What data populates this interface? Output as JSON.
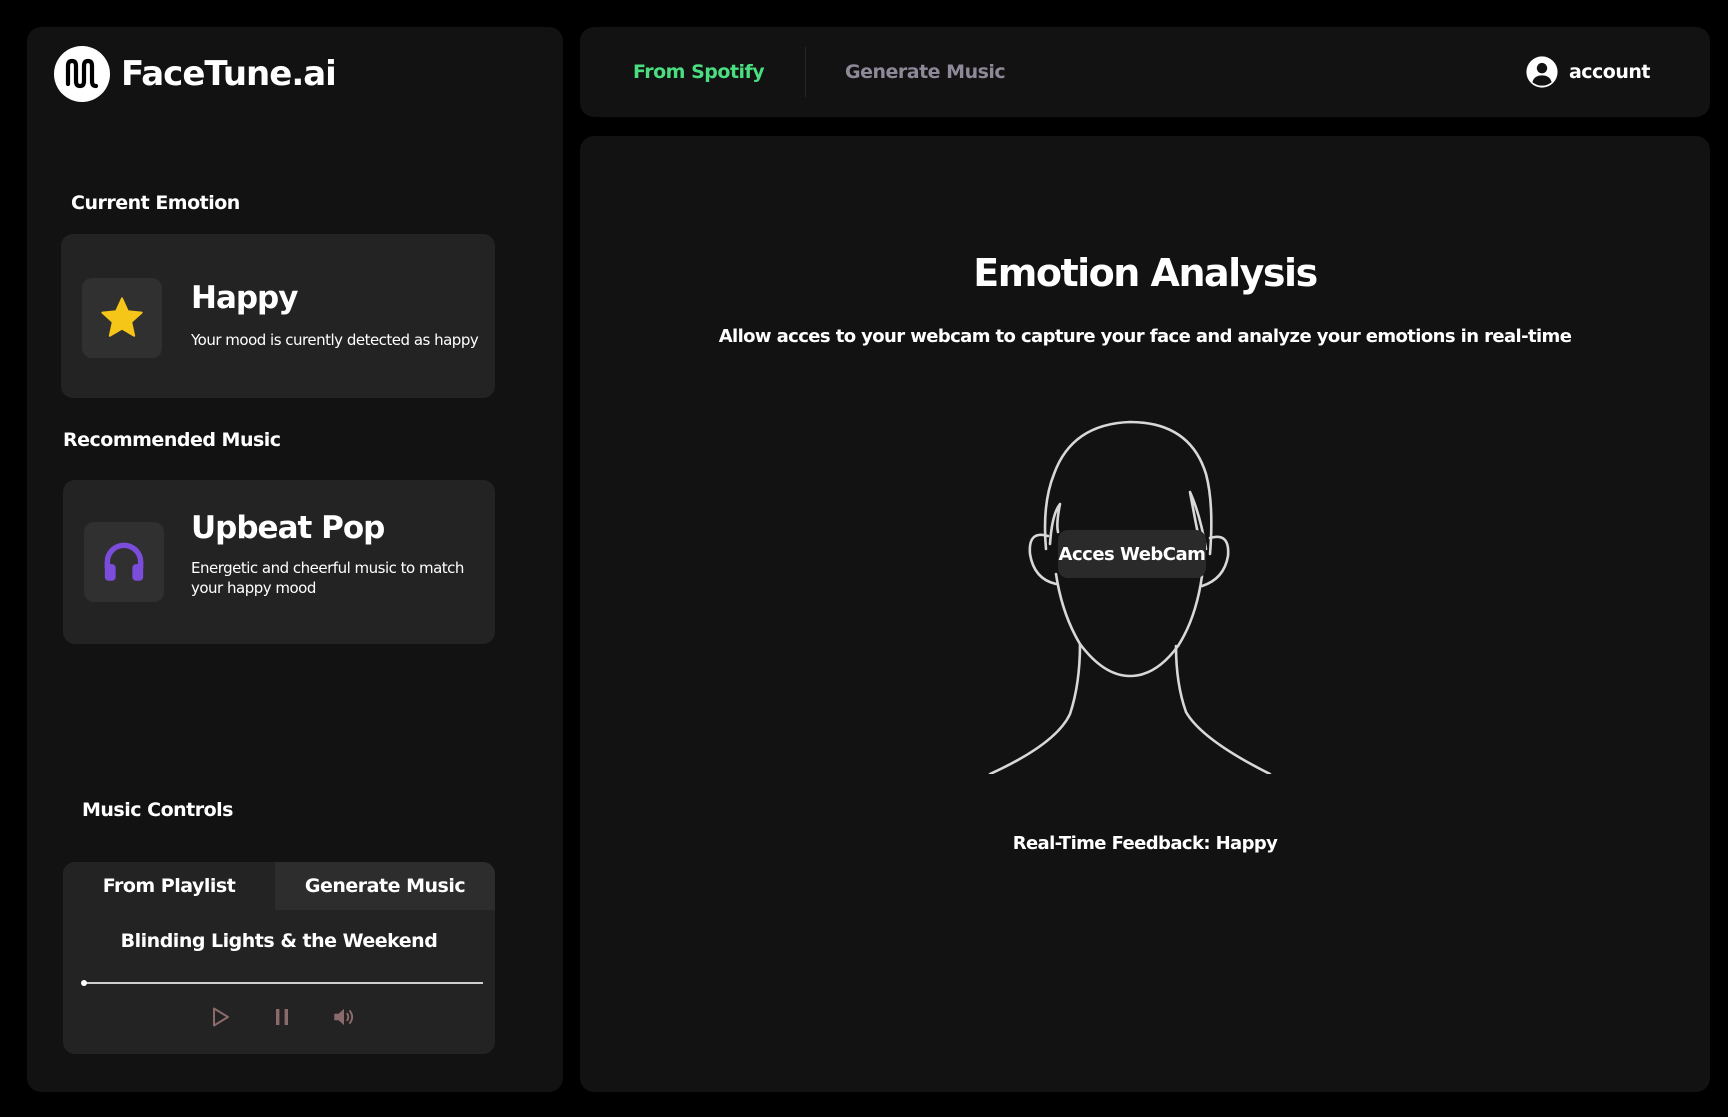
{
  "app": {
    "brand_name": "FaceTune.ai"
  },
  "colors": {
    "accent_green": "#4ade80",
    "accent_purple": "#7c4ddb",
    "star_yellow": "#f5c518",
    "muted_text": "#8e8899",
    "panel_bg": "#121212",
    "card_bg": "#232323"
  },
  "sidebar": {
    "current_emotion": {
      "label": "Current Emotion",
      "icon": "star-icon",
      "title": "Happy",
      "description": "Your mood is curently detected as happy"
    },
    "recommended_music": {
      "label": "Recommended Music",
      "icon": "headphones-icon",
      "title": "Upbeat Pop",
      "description": "Energetic and cheerful music to match your happy mood"
    },
    "music_controls": {
      "label": "Music Controls",
      "tabs": [
        {
          "label": "From Playlist",
          "active": true
        },
        {
          "label": "Generate Music",
          "active": false
        }
      ],
      "track_title": "Blinding Lights & the Weekend",
      "progress": 0.0,
      "buttons": [
        {
          "icon": "play-icon"
        },
        {
          "icon": "pause-icon"
        },
        {
          "icon": "volume-icon"
        }
      ]
    }
  },
  "topnav": {
    "tabs": [
      {
        "label": "From Spotify",
        "active": true
      },
      {
        "label": "Generate Music",
        "active": false
      }
    ],
    "account_label": "account",
    "account_icon": "user-circle-icon"
  },
  "main": {
    "title": "Emotion Analysis",
    "subtitle": "Allow acces to your webcam to capture your face and analyze your emotions in real-time",
    "webcam_button": "Acces WebCam",
    "feedback": "Real-Time Feedback: Happy"
  }
}
